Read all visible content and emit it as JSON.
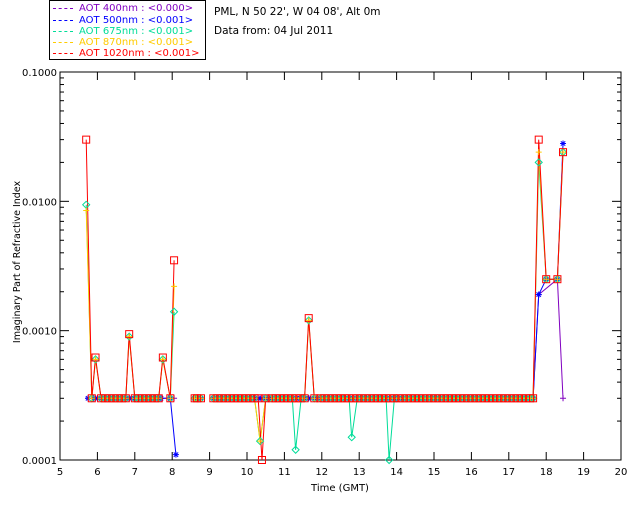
{
  "legend": {
    "items": [
      {
        "label": "AOT  400nm : <0.000>",
        "color": "#8000c0"
      },
      {
        "label": "AOT  500nm : <0.001>",
        "color": "#0000ff"
      },
      {
        "label": "AOT  675nm : <0.001>",
        "color": "#00dd99"
      },
      {
        "label": "AOT  870nm : <0.001>",
        "color": "#ffcc00"
      },
      {
        "label": "AOT 1020nm : <0.001>",
        "color": "#ff0000"
      }
    ]
  },
  "info": {
    "site_line": "PML, N 50 22', W 04 08', Alt 0m",
    "date_line": "Data from: 04 Jul 2011"
  },
  "chart_data": {
    "type": "line",
    "title": "",
    "xlabel": "Time (GMT)",
    "ylabel": "Imaginary Part of Refractive Index",
    "xlim": [
      5,
      20
    ],
    "ylim": [
      0.0001,
      0.1
    ],
    "yscale": "log",
    "x_ticks": [
      "5",
      "6",
      "7",
      "8",
      "9",
      "10",
      "11",
      "12",
      "13",
      "14",
      "15",
      "16",
      "17",
      "18",
      "19",
      "20"
    ],
    "y_ticks": [
      "0.0001",
      "0.0010",
      "0.0100",
      "0.1000"
    ],
    "series": [
      {
        "name": "AOT  400nm : <0.000>",
        "color": "#8000c0",
        "marker": "+",
        "x": [
          5.75,
          5.9,
          6.0,
          6.85,
          7.7,
          7.9,
          8.05,
          8.6,
          10.35,
          10.45,
          11.65,
          11.8,
          17.65,
          17.8,
          18.3,
          18.45
        ],
        "y": [
          0.0003,
          0.0003,
          0.0003,
          0.0003,
          0.0003,
          0.0003,
          0.0003,
          0.0003,
          0.0003,
          0.0003,
          0.0003,
          0.0003,
          0.0003,
          0.0019,
          0.0025,
          0.0003
        ]
      },
      {
        "name": "AOT  500nm : <0.001>",
        "color": "#0000ff",
        "marker": "*",
        "x": [
          5.75,
          5.9,
          6.0,
          6.85,
          7.7,
          7.95,
          8.1,
          8.6,
          10.3,
          10.4,
          10.5,
          11.65,
          11.8,
          17.65,
          17.8,
          18.0,
          18.3,
          18.45
        ],
        "y": [
          0.0003,
          0.0003,
          0.0003,
          0.0003,
          0.0003,
          0.0003,
          0.00011,
          0.0003,
          0.0003,
          0.0003,
          0.0003,
          0.0003,
          0.0003,
          0.0003,
          0.0019,
          0.0025,
          0.0025,
          0.028
        ]
      },
      {
        "name": "AOT  675nm : <0.001>",
        "color": "#00dd99",
        "marker": "diamond",
        "x": [
          5.7,
          5.85,
          5.95,
          6.1,
          6.85,
          7.0,
          7.75,
          7.95,
          8.05,
          8.6,
          10.35,
          10.5,
          11.1,
          11.3,
          11.45,
          11.65,
          11.8,
          12.6,
          12.8,
          12.95,
          13.6,
          13.8,
          14.0,
          17.65,
          17.8,
          18.0,
          18.3,
          18.45
        ],
        "y": [
          0.0094,
          0.0003,
          0.0006,
          0.0003,
          0.0009,
          0.0003,
          0.0006,
          0.0003,
          0.0014,
          0.0003,
          0.00014,
          0.0003,
          0.0003,
          0.00012,
          0.0003,
          0.0012,
          0.0003,
          0.0003,
          0.00015,
          0.0003,
          0.0003,
          0.0001,
          0.0003,
          0.0003,
          0.02,
          0.0025,
          0.0025,
          0.024
        ]
      },
      {
        "name": "AOT  870nm : <0.001>",
        "color": "#ffcc00",
        "marker": "+",
        "x": [
          5.7,
          5.85,
          5.95,
          6.1,
          6.85,
          7.0,
          7.75,
          7.95,
          8.05,
          8.6,
          10.35,
          10.5,
          11.65,
          11.8,
          17.65,
          17.8,
          18.0,
          18.3,
          18.45
        ],
        "y": [
          0.0085,
          0.0003,
          0.0006,
          0.0003,
          0.0009,
          0.0003,
          0.0006,
          0.0003,
          0.0022,
          0.0003,
          0.00014,
          0.0003,
          0.0012,
          0.0003,
          0.0003,
          0.024,
          0.0025,
          0.0025,
          0.024
        ]
      },
      {
        "name": "AOT 1020nm : <0.001>",
        "color": "#ff0000",
        "marker": "square",
        "x": [
          5.7,
          5.85,
          5.95,
          6.1,
          6.85,
          7.0,
          7.75,
          7.95,
          8.05,
          8.6,
          10.3,
          10.4,
          10.5,
          11.65,
          11.8,
          17.65,
          17.8,
          18.0,
          18.3,
          18.45
        ],
        "y": [
          0.03,
          0.0003,
          0.00062,
          0.0003,
          0.00094,
          0.0003,
          0.00062,
          0.0003,
          0.0035,
          0.0003,
          0.0003,
          0.0001,
          0.0003,
          0.00125,
          0.0003,
          0.0003,
          0.03,
          0.0025,
          0.0025,
          0.024
        ]
      }
    ],
    "segments": [
      [
        5.7,
        6.1
      ],
      [
        6.1,
        8.1
      ],
      [
        8.6,
        17.65
      ],
      [
        17.65,
        18.5
      ]
    ],
    "dense_region": {
      "x_ranges": [
        [
          6.1,
          7.7
        ],
        [
          8.55,
          8.85
        ],
        [
          9.1,
          10.2
        ],
        [
          10.55,
          11.55
        ],
        [
          11.85,
          17.6
        ]
      ],
      "spacing": 0.11,
      "y": 0.0003
    },
    "grid": false,
    "legend_position": "top-left"
  }
}
